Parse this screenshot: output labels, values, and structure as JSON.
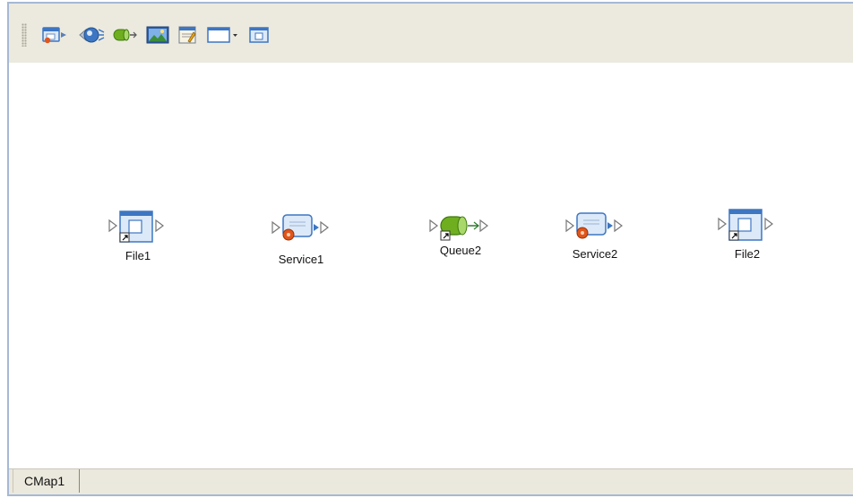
{
  "toolbar": {
    "buttons": [
      {
        "name": "file-external-icon",
        "tooltip": ""
      },
      {
        "name": "service-icon",
        "tooltip": ""
      },
      {
        "name": "queue-icon",
        "tooltip": ""
      },
      {
        "name": "image-icon",
        "tooltip": ""
      },
      {
        "name": "notes-icon",
        "tooltip": ""
      },
      {
        "name": "window-dropdown-icon",
        "tooltip": ""
      },
      {
        "name": "window-icon",
        "tooltip": ""
      }
    ]
  },
  "canvas": {
    "components": [
      {
        "label": "File1",
        "type": "file",
        "icon": "file-icon"
      },
      {
        "label": "Service1",
        "type": "service",
        "icon": "service-icon"
      },
      {
        "label": "Queue2",
        "type": "queue",
        "icon": "queue-icon"
      },
      {
        "label": "Service2",
        "type": "service",
        "icon": "service-icon"
      },
      {
        "label": "File2",
        "type": "file",
        "icon": "file-icon"
      }
    ]
  },
  "tabs": [
    {
      "label": "CMap1",
      "active": true
    }
  ],
  "colors": {
    "toolbar_bg": "#eceadf",
    "frame_border": "#a6b8d4",
    "queue_green": "#6fae1f",
    "service_orange": "#e0561c",
    "window_blue": "#3d76c2"
  }
}
